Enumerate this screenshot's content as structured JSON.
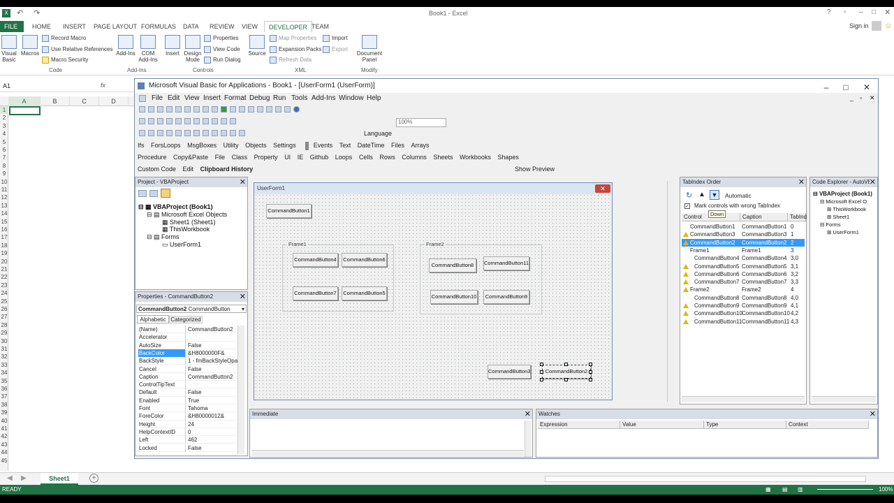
{
  "excel": {
    "title": "Book1 - Excel",
    "tabs": [
      "FILE",
      "HOME",
      "INSERT",
      "PAGE LAYOUT",
      "FORMULAS",
      "DATA",
      "REVIEW",
      "VIEW",
      "DEVELOPER",
      "TEAM"
    ],
    "signin": "Sign in",
    "ribbon": {
      "visual_basic": "Visual Basic",
      "macros": "Macros",
      "record_macro": "Record Macro",
      "relative_refs": "Use Relative References",
      "macro_security": "Macro Security",
      "group_code": "Code",
      "addins": "Add-Ins",
      "com_addins": "COM Add-Ins",
      "group_addins": "Add-Ins",
      "insert": "Insert",
      "design_mode": "Design Mode",
      "properties": "Properties",
      "view_code": "View Code",
      "run_dialog": "Run Dialog",
      "group_controls": "Controls",
      "source": "Source",
      "map_properties": "Map Properties",
      "expansion_packs": "Expansion Packs",
      "refresh_data": "Refresh Data",
      "import": "Import",
      "export": "Export",
      "group_xml": "XML",
      "document_panel": "Document Panel",
      "group_modify": "Modify"
    },
    "name_box": "A1",
    "fx": "fx",
    "columns": [
      "A",
      "B",
      "C",
      "D"
    ],
    "rows": [
      "1",
      "2",
      "3",
      "4",
      "5",
      "6",
      "7",
      "8",
      "9",
      "10",
      "11",
      "12",
      "13",
      "14",
      "15",
      "16",
      "17",
      "18",
      "19",
      "20",
      "21",
      "22",
      "23",
      "24",
      "25",
      "26",
      "27",
      "28",
      "29",
      "30",
      "31",
      "32",
      "33",
      "34",
      "35",
      "36",
      "37",
      "38",
      "39",
      "40",
      "41",
      "42",
      "43",
      "44",
      "45"
    ],
    "sheet_tab": "Sheet1",
    "status": "READY",
    "zoom": "100%"
  },
  "vbe": {
    "title": "Microsoft Visual Basic for Applications - Book1 - [UserForm1 (UserForm)]",
    "menu": [
      "File",
      "Edit",
      "View",
      "Insert",
      "Format",
      "Debug",
      "Run",
      "Tools",
      "Add-Ins",
      "Window",
      "Help"
    ],
    "toolbar4": [
      "Ifs",
      "ForsLoops",
      "MsgBoxes",
      "Utility",
      "Objects",
      "Settings",
      "Events",
      "Text",
      "DateTime",
      "Files",
      "Arrays"
    ],
    "toolbar5": [
      "Procedure",
      "Copy&Paste",
      "File",
      "Class",
      "Property",
      "UI",
      "IE",
      "Github",
      "Loops",
      "Cells",
      "Rows",
      "Columns",
      "Sheets",
      "Workbooks",
      "Shapes"
    ],
    "toolbar6": [
      "Custom Code",
      "Edit",
      "Clipboard History",
      "Show Preview"
    ],
    "zoom": "100%",
    "language": "Language",
    "project": {
      "title": "Project - VBAProject",
      "items": [
        "VBAProject (Book1)",
        "Microsoft Excel Objects",
        "Sheet1 (Sheet1)",
        "ThisWorkbook",
        "Forms",
        "UserForm1"
      ]
    },
    "properties": {
      "title": "Properties - CommandButton2",
      "object": "CommandButton2",
      "object_type": "CommandButton",
      "tabs": [
        "Alphabetic",
        "Categorized"
      ],
      "rows": [
        {
          "k": "(Name)",
          "v": "CommandButton2"
        },
        {
          "k": "Accelerator",
          "v": ""
        },
        {
          "k": "AutoSize",
          "v": "False"
        },
        {
          "k": "BackColor",
          "v": "&H8000000F&"
        },
        {
          "k": "BackStyle",
          "v": "1 - fmBackStyleOpa"
        },
        {
          "k": "Cancel",
          "v": "False"
        },
        {
          "k": "Caption",
          "v": "CommandButton2"
        },
        {
          "k": "ControlTipText",
          "v": ""
        },
        {
          "k": "Default",
          "v": "False"
        },
        {
          "k": "Enabled",
          "v": "True"
        },
        {
          "k": "Font",
          "v": "Tahoma"
        },
        {
          "k": "ForeColor",
          "v": "&H80000012&"
        },
        {
          "k": "Height",
          "v": "24"
        },
        {
          "k": "HelpContextID",
          "v": "0"
        },
        {
          "k": "Left",
          "v": "462"
        },
        {
          "k": "Locked",
          "v": "False"
        }
      ]
    },
    "userform": {
      "title": "UserForm1",
      "frame1": "Frame1",
      "frame2": "Frame2",
      "buttons": {
        "b1": "CommandButton1",
        "b4": "CommandButton4",
        "b6": "CommandButton6",
        "b7": "CommandButton7",
        "b5": "CommandButton5",
        "b8": "CommandButton8",
        "b11": "CommandButton11",
        "b10": "CommandButton10",
        "b9": "CommandButton9",
        "b3": "CommandButton3",
        "b2": "CommandButton2"
      }
    },
    "tab_order": {
      "title": "TabIndex Order",
      "mode": "Automatic",
      "tooltip": "Down",
      "checkbox": "Mark controls with wrong TabIndex",
      "headers": [
        "Control",
        "Caption",
        "TabInd"
      ],
      "rows": [
        {
          "c": "CommandButton1",
          "cap": "CommandButton1",
          "t": "0",
          "warn": false,
          "indent": false
        },
        {
          "c": "CommandButton3",
          "cap": "CommandButton3",
          "t": "1",
          "warn": true,
          "indent": false
        },
        {
          "c": "CommandButton2",
          "cap": "CommandButton2",
          "t": "2",
          "warn": true,
          "indent": false
        },
        {
          "c": "Frame1",
          "cap": "Frame1",
          "t": "3",
          "warn": false,
          "indent": false
        },
        {
          "c": "CommandButton4",
          "cap": "CommandButton4",
          "t": "3,0",
          "warn": false,
          "indent": true
        },
        {
          "c": "CommandButton5",
          "cap": "CommandButton5",
          "t": "3,1",
          "warn": true,
          "indent": true
        },
        {
          "c": "CommandButton6",
          "cap": "CommandButton6",
          "t": "3,2",
          "warn": true,
          "indent": true
        },
        {
          "c": "CommandButton7",
          "cap": "CommandButton7",
          "t": "3,3",
          "warn": true,
          "indent": true
        },
        {
          "c": "Frame2",
          "cap": "Frame2",
          "t": "4",
          "warn": true,
          "indent": false
        },
        {
          "c": "CommandButton8",
          "cap": "CommandButton8",
          "t": "4,0",
          "warn": false,
          "indent": true
        },
        {
          "c": "CommandButton9",
          "cap": "CommandButton9",
          "t": "4,1",
          "warn": true,
          "indent": true
        },
        {
          "c": "CommandButton10",
          "cap": "CommandButton10",
          "t": "4,2",
          "warn": true,
          "indent": true
        },
        {
          "c": "CommandButton11",
          "cap": "CommandButton11",
          "t": "4,3",
          "warn": true,
          "indent": true
        }
      ]
    },
    "code_explorer": {
      "title": "Code Explorer - AutoVBA",
      "items": [
        "VBAProject (Book1)",
        "Microsoft Excel O",
        "ThisWorkbook",
        "Sheet1",
        "Forms",
        "UserForm1"
      ]
    },
    "immediate": {
      "title": "Immediate"
    },
    "watches": {
      "title": "Watches",
      "headers": [
        "Expression",
        "Value",
        "Type",
        "Context"
      ]
    }
  },
  "colors": {
    "excel_green": "#217346",
    "selection": "#3399ff",
    "warning": "#e8b400"
  }
}
